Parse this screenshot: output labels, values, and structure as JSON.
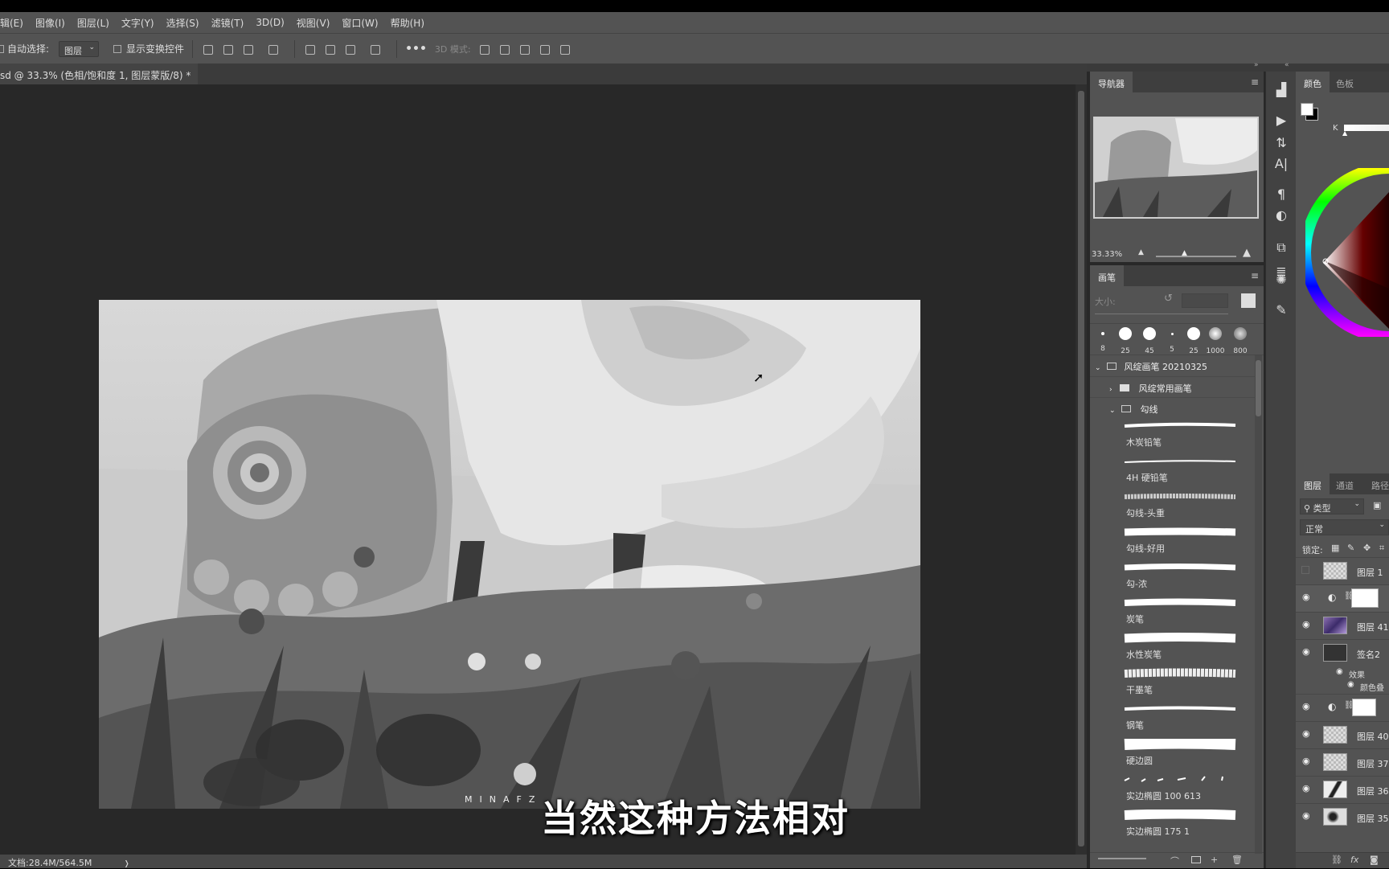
{
  "menubar": {
    "items": [
      "辑(E)",
      "图像(I)",
      "图层(L)",
      "文字(Y)",
      "选择(S)",
      "滤镜(T)",
      "3D(D)",
      "视图(V)",
      "窗口(W)",
      "帮助(H)"
    ]
  },
  "options": {
    "auto_select_label": "自动选择:",
    "auto_select_value": "图层",
    "show_transform_label": "显示变换控件",
    "mode_3d_label": "3D 模式:"
  },
  "document": {
    "tab_title": "sd @ 33.3% (色相/饱和度 1, 图层蒙版/8) *",
    "close_glyph": "×",
    "watermark": "MINAFZ",
    "status": "文档:28.4M/564.5M",
    "status_arrow": "❭"
  },
  "subtitle": "当然这种方法相对",
  "navigator": {
    "title": "导航器",
    "zoom": "33.33%"
  },
  "brush_panel": {
    "title": "画笔",
    "size_label": "大小:",
    "presets": [
      "8",
      "25",
      "45",
      "5",
      "25",
      "1000",
      "800"
    ],
    "tree": [
      {
        "label": "风绽画笔 20210325",
        "level": 0,
        "expanded": true
      },
      {
        "label": "风绽常用画笔",
        "level": 1,
        "expanded": false
      },
      {
        "label": "勾线",
        "level": 1,
        "expanded": true
      }
    ],
    "brushes": [
      "木炭铅笔",
      "4H 硬铅笔",
      "勾线-头重",
      "勾线-好用",
      "勾-浓",
      "炭笔",
      "水性炭笔",
      "干墨笔",
      "钢笔",
      "硬边圆",
      "实边椭圆 100 613",
      "实边椭圆 175 1"
    ]
  },
  "color_panel": {
    "tabs": [
      "颜色",
      "色板"
    ],
    "channel_label": "K",
    "hue_colors": [
      "#ff0000",
      "#ffff00",
      "#00ff00",
      "#00ffff",
      "#0000ff",
      "#ff00ff"
    ]
  },
  "layers_panel": {
    "tabs": [
      "图层",
      "通道",
      "路径"
    ],
    "filter_label": "类型",
    "blend_mode": "正常",
    "lock_label": "锁定:",
    "layers": [
      {
        "name": "图层 1",
        "visible": false,
        "thumb": "checker"
      },
      {
        "name": "",
        "visible": true,
        "thumb": "adjust"
      },
      {
        "name": "图层 41",
        "visible": true,
        "thumb": "purple"
      },
      {
        "name": "签名2",
        "visible": true,
        "thumb": "signature"
      },
      {
        "name": "效果",
        "visible": true,
        "thumb": "effect"
      },
      {
        "name": "颜色叠",
        "visible": true,
        "thumb": "effect"
      },
      {
        "name": "",
        "visible": true,
        "thumb": "adjust"
      },
      {
        "name": "图层 40",
        "visible": true,
        "thumb": "checker"
      },
      {
        "name": "图层 37",
        "visible": true,
        "thumb": "checker"
      },
      {
        "name": "图层 36",
        "visible": true,
        "thumb": "stroke"
      },
      {
        "name": "图层 35",
        "visible": true,
        "thumb": "dots"
      }
    ],
    "footer_fx": "fx"
  }
}
